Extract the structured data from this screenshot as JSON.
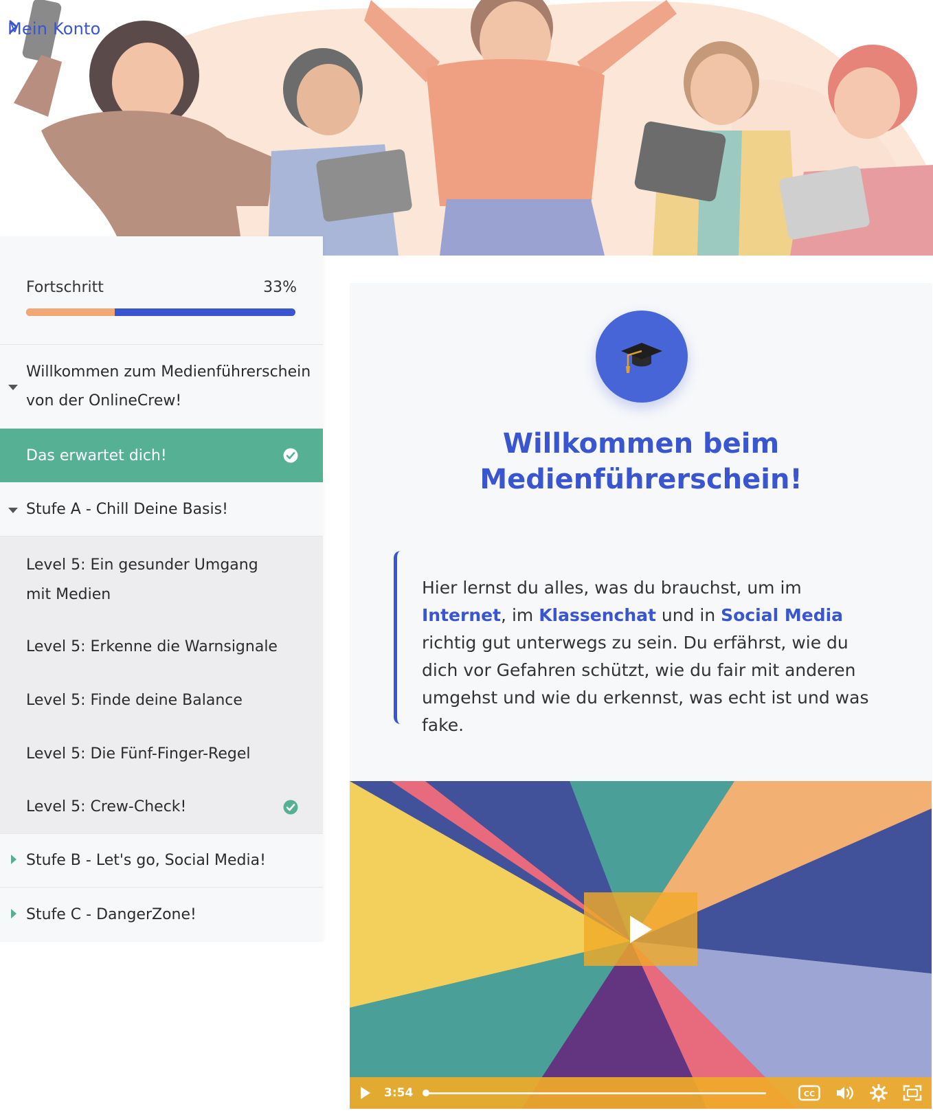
{
  "breadcrumb": {
    "account_label": "Mein Konto"
  },
  "progress": {
    "label": "Fortschritt",
    "percent_text": "33%",
    "value": 0.33
  },
  "nav": {
    "intro_section": "Willkommen zum Medienführerschein von der OnlineCrew!",
    "active_lesson": "Das erwartet dich!",
    "section_a": "Stufe A - Chill Deine Basis!",
    "lessons": [
      "Level 5: Ein gesunder Umgang mit Medien",
      "Level 5: Erkenne die Warnsignale",
      "Level 5: Finde deine Balance",
      "Level 5: Die Fünf-Finger-Regel",
      "Level 5: Crew-Check!"
    ],
    "section_b": "Stufe B - Let's go, Social Media!",
    "section_c": "Stufe C - DangerZone!"
  },
  "content": {
    "title_line1": "Willkommen beim",
    "title_line2": "Medienführerschein!",
    "intro": {
      "t1": "Hier lernst du alles, was du brauchst, um im ",
      "h1": "Internet",
      "t2": ", im ",
      "h2": "Klassenchat",
      "t3": " und in ",
      "h3": "Social Media",
      "t4": " richtig gut unterwegs zu sein. Du erfährst, wie du dich vor Gefahren schützt, wie du fair mit anderen umgehst und wie du erkennst, was echt ist und was fake."
    }
  },
  "video": {
    "duration": "3:54",
    "played_fraction": 0
  },
  "colors": {
    "accent_blue": "#3a55d0",
    "complete_green": "#55b094",
    "progress_orange": "#f2a874",
    "video_controls": "#f0aa28"
  },
  "icons": [
    "chevron-right-icon",
    "caret-down-icon",
    "caret-right-icon",
    "check-circle-icon",
    "graduation-cap-icon",
    "play-icon",
    "cc-icon",
    "volume-icon",
    "settings-icon",
    "fullscreen-icon"
  ]
}
